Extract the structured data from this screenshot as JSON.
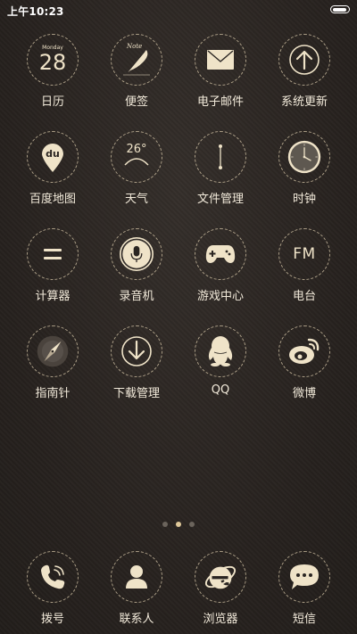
{
  "status_bar": {
    "time": "上午10:23"
  },
  "calendar": {
    "month_small": "Monday",
    "day": "28"
  },
  "apps": [
    {
      "label": "日历",
      "icon": "calendar-icon"
    },
    {
      "label": "便签",
      "icon": "notes-feather-icon"
    },
    {
      "label": "电子邮件",
      "icon": "envelope-icon"
    },
    {
      "label": "系统更新",
      "icon": "up-arrow-icon"
    },
    {
      "label": "百度地图",
      "icon": "map-pin-icon"
    },
    {
      "label": "天气",
      "icon": "weather-icon"
    },
    {
      "label": "文件管理",
      "icon": "file-icon"
    },
    {
      "label": "时钟",
      "icon": "clock-icon"
    },
    {
      "label": "计算器",
      "icon": "equals-icon"
    },
    {
      "label": "录音机",
      "icon": "microphone-icon"
    },
    {
      "label": "游戏中心",
      "icon": "gamepad-icon"
    },
    {
      "label": "电台",
      "icon": "fm-icon"
    },
    {
      "label": "指南针",
      "icon": "compass-icon"
    },
    {
      "label": "下载管理",
      "icon": "download-icon"
    },
    {
      "label": "QQ",
      "icon": "penguin-icon"
    },
    {
      "label": "微博",
      "icon": "weibo-icon"
    }
  ],
  "icon_text": {
    "notes": "Note",
    "map": "du",
    "weather": "26°",
    "radio": "FM"
  },
  "pager": {
    "count": 3,
    "active": 2
  },
  "dock": [
    {
      "label": "拨号",
      "icon": "phone-icon"
    },
    {
      "label": "联系人",
      "icon": "contact-icon"
    },
    {
      "label": "浏览器",
      "icon": "browser-icon"
    },
    {
      "label": "短信",
      "icon": "message-icon"
    }
  ],
  "colors": {
    "accent": "#e0c99a",
    "icon": "#efe3c8",
    "ring": "#d8c9aa",
    "background": "#2a2522"
  }
}
